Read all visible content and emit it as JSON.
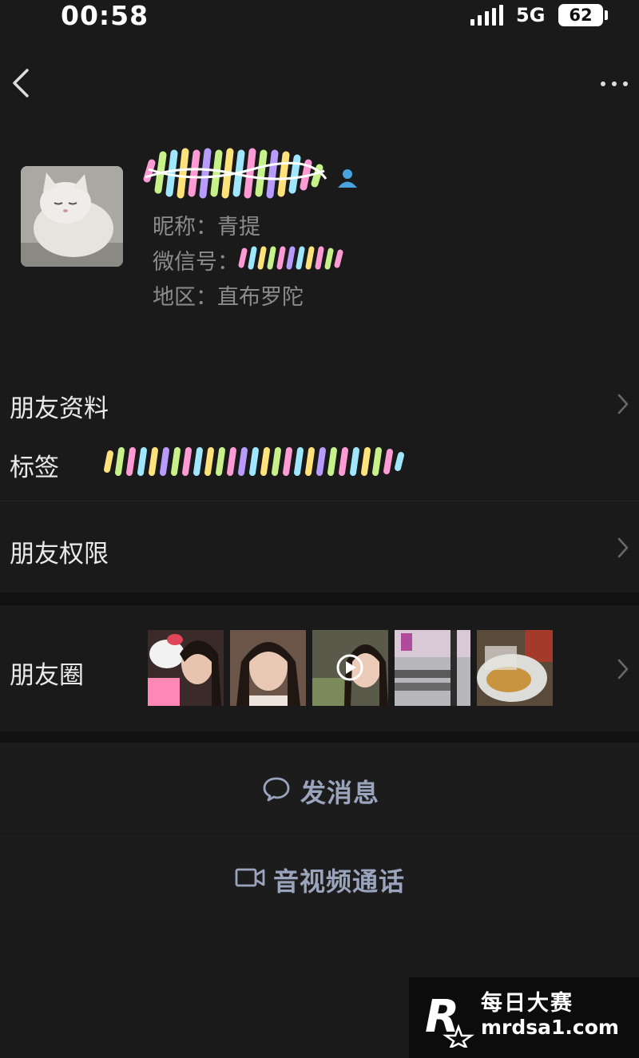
{
  "status_bar": {
    "time": "00:58",
    "network": "5G",
    "battery": "62"
  },
  "nav": {
    "back_icon": "chevron-left-icon",
    "more_icon": "more-dots-icon"
  },
  "profile": {
    "avatar_icon": "cat-avatar",
    "remark_name_redacted": true,
    "nickname_label": "昵称：",
    "nickname_value": "青提",
    "wechat_id_label": "微信号：",
    "region_label": "地区：",
    "region_value": "直布罗陀"
  },
  "rows": {
    "friend_info": "朋友资料",
    "tags": "标签",
    "friend_permissions": "朋友权限",
    "moments": "朋友圈"
  },
  "actions": {
    "send_message": "发消息",
    "video_call": "音视频通话"
  },
  "watermark": {
    "line1": "每日大赛",
    "line2": "mrdsa1.com",
    "badge_letter": "R"
  },
  "colors": {
    "background": "#1a1a1a",
    "action_text": "#9aa5bd",
    "friend_icon": "#4aa3df"
  }
}
